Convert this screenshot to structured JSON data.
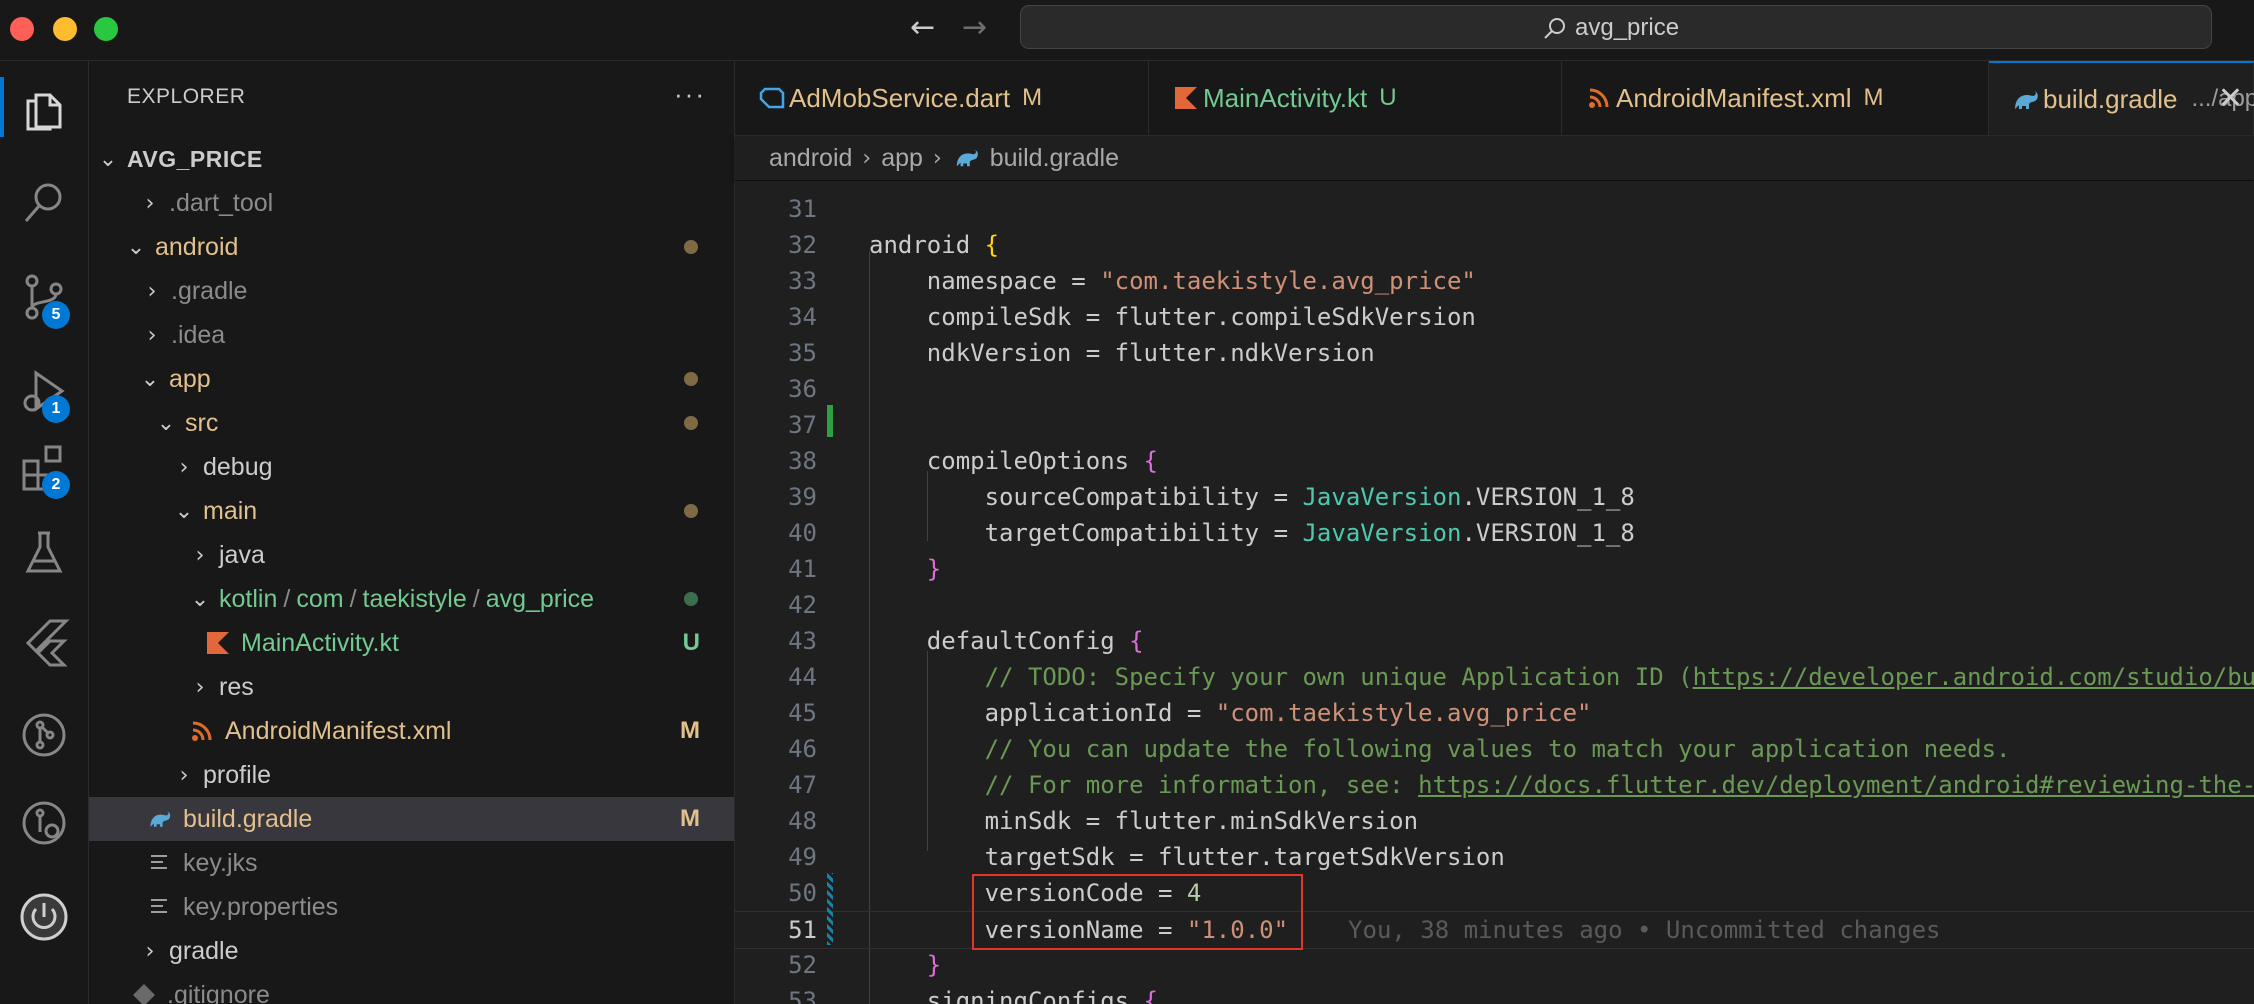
{
  "window": {
    "search_text": "avg_price"
  },
  "activity_bar": {
    "items": [
      {
        "name": "explorer-icon",
        "badge": ""
      },
      {
        "name": "search-icon",
        "badge": ""
      },
      {
        "name": "source-control-icon",
        "badge": "5"
      },
      {
        "name": "run-debug-icon",
        "badge": "1"
      },
      {
        "name": "extensions-icon",
        "badge": "2"
      },
      {
        "name": "testing-icon",
        "badge": ""
      },
      {
        "name": "flutter-icon",
        "badge": ""
      },
      {
        "name": "git-graph-icon",
        "badge": ""
      },
      {
        "name": "gitlens-icon",
        "badge": ""
      },
      {
        "name": "power-icon",
        "badge": ""
      }
    ]
  },
  "explorer": {
    "title": "EXPLORER",
    "more": "···",
    "root": "AVG_PRICE",
    "tree": [
      {
        "label": ".dart_tool",
        "chev": "›",
        "color": "dim",
        "status": ""
      },
      {
        "label": "android",
        "chev": "⌄",
        "color": "mod",
        "status": "dot"
      },
      {
        "label": ".gradle",
        "chev": "›",
        "color": "dim",
        "status": ""
      },
      {
        "label": ".idea",
        "chev": "›",
        "color": "dim",
        "status": ""
      },
      {
        "label": "app",
        "chev": "⌄",
        "color": "mod",
        "status": "dot"
      },
      {
        "label": "src",
        "chev": "⌄",
        "color": "mod",
        "status": "dot"
      },
      {
        "label": "debug",
        "chev": "›",
        "color": "white",
        "status": ""
      },
      {
        "label": "main",
        "chev": "⌄",
        "color": "mod",
        "status": "dot"
      },
      {
        "label": "java",
        "chev": "›",
        "color": "white",
        "status": ""
      },
      {
        "label": "kotlin",
        "path_rest": [
          "com",
          "taekistyle",
          "avg_price"
        ],
        "chev": "⌄",
        "color": "new",
        "status": "dot-new"
      },
      {
        "label": "MainActivity.kt",
        "chev": "",
        "color": "new",
        "status": "U",
        "icon": "kotlin-file-icon"
      },
      {
        "label": "res",
        "chev": "›",
        "color": "white",
        "status": ""
      },
      {
        "label": "AndroidManifest.xml",
        "chev": "",
        "color": "mod",
        "status": "M",
        "icon": "xml-file-icon"
      },
      {
        "label": "profile",
        "chev": "›",
        "color": "white",
        "status": ""
      },
      {
        "label": "build.gradle",
        "chev": "",
        "color": "mod",
        "status": "M",
        "icon": "gradle-file-icon",
        "selected": true
      },
      {
        "label": "key.jks",
        "chev": "",
        "color": "dim",
        "status": "",
        "icon": "text-file-icon"
      },
      {
        "label": "key.properties",
        "chev": "",
        "color": "dim",
        "status": "",
        "icon": "text-file-icon"
      },
      {
        "label": "gradle",
        "chev": "›",
        "color": "white",
        "status": ""
      },
      {
        "label": ".gitignore",
        "chev": "",
        "color": "dim",
        "status": "",
        "icon": "git-file-icon"
      }
    ]
  },
  "tabs": [
    {
      "label": "AdMobService.dart",
      "status": "M",
      "color": "mod",
      "icon": "dart-file-icon"
    },
    {
      "label": "MainActivity.kt",
      "status": "U",
      "color": "new",
      "icon": "kotlin-file-icon"
    },
    {
      "label": "AndroidManifest.xml",
      "status": "M",
      "color": "mod",
      "icon": "xml-file-icon"
    },
    {
      "label": "build.gradle",
      "description": ".../app",
      "status": "M",
      "color": "mod",
      "icon": "gradle-file-icon",
      "active": true
    }
  ],
  "breadcrumb": [
    "android",
    "app",
    "build.gradle"
  ],
  "editor": {
    "current_line": 51,
    "blame": "You, 38 minutes ago • Uncommitted changes",
    "lines": [
      {
        "n": 31,
        "tokens": []
      },
      {
        "n": 32,
        "tokens": [
          [
            "k",
            "android "
          ],
          [
            "br1",
            "{"
          ]
        ]
      },
      {
        "n": 33,
        "tokens": [
          [
            "k",
            "    namespace = "
          ],
          [
            "s",
            "\"com.taekistyle.avg_price\""
          ]
        ]
      },
      {
        "n": 34,
        "tokens": [
          [
            "k",
            "    compileSdk = flutter.compileSdkVersion"
          ]
        ]
      },
      {
        "n": 35,
        "tokens": [
          [
            "k",
            "    ndkVersion = flutter.ndkVersion"
          ]
        ]
      },
      {
        "n": 36,
        "tokens": []
      },
      {
        "n": 37,
        "tokens": []
      },
      {
        "n": 38,
        "tokens": [
          [
            "k",
            "    compileOptions "
          ],
          [
            "br2",
            "{"
          ]
        ]
      },
      {
        "n": 39,
        "tokens": [
          [
            "k",
            "        sourceCompatibility = "
          ],
          [
            "ty",
            "JavaVersion"
          ],
          [
            "k",
            ".VERSION_1_8"
          ]
        ]
      },
      {
        "n": 40,
        "tokens": [
          [
            "k",
            "        targetCompatibility = "
          ],
          [
            "ty",
            "JavaVersion"
          ],
          [
            "k",
            ".VERSION_1_8"
          ]
        ]
      },
      {
        "n": 41,
        "tokens": [
          [
            "br2",
            "    }"
          ]
        ]
      },
      {
        "n": 42,
        "tokens": []
      },
      {
        "n": 43,
        "tokens": [
          [
            "k",
            "    defaultConfig "
          ],
          [
            "br2",
            "{"
          ]
        ]
      },
      {
        "n": 44,
        "tokens": [
          [
            "cm",
            "        // TODO: Specify your own unique Application ID ("
          ],
          [
            "url",
            "https://developer.android.com/studio/bu"
          ]
        ]
      },
      {
        "n": 45,
        "tokens": [
          [
            "k",
            "        applicationId = "
          ],
          [
            "s",
            "\"com.taekistyle.avg_price\""
          ]
        ]
      },
      {
        "n": 46,
        "tokens": [
          [
            "cm",
            "        // You can update the following values to match your application needs."
          ]
        ]
      },
      {
        "n": 47,
        "tokens": [
          [
            "cm",
            "        // For more information, see: "
          ],
          [
            "url",
            "https://docs.flutter.dev/deployment/android#reviewing-the-"
          ]
        ]
      },
      {
        "n": 48,
        "tokens": [
          [
            "k",
            "        minSdk = flutter.minSdkVersion"
          ]
        ]
      },
      {
        "n": 49,
        "tokens": [
          [
            "k",
            "        targetSdk = flutter.targetSdkVersion"
          ]
        ]
      },
      {
        "n": 50,
        "tokens": [
          [
            "k",
            "        versionCode = "
          ],
          [
            "n",
            "4"
          ]
        ]
      },
      {
        "n": 51,
        "tokens": [
          [
            "k",
            "        versionName = "
          ],
          [
            "s",
            "\"1.0.0\""
          ]
        ]
      },
      {
        "n": 52,
        "tokens": [
          [
            "br2",
            "    }"
          ]
        ]
      },
      {
        "n": 53,
        "tokens": [
          [
            "k",
            "    signingConfigs "
          ],
          [
            "br2",
            "{"
          ]
        ]
      }
    ]
  },
  "colors": {
    "modified": "#e2c08d",
    "untracked": "#73c991",
    "accent": "#0078d4",
    "highlight_box": "#e0352b"
  }
}
